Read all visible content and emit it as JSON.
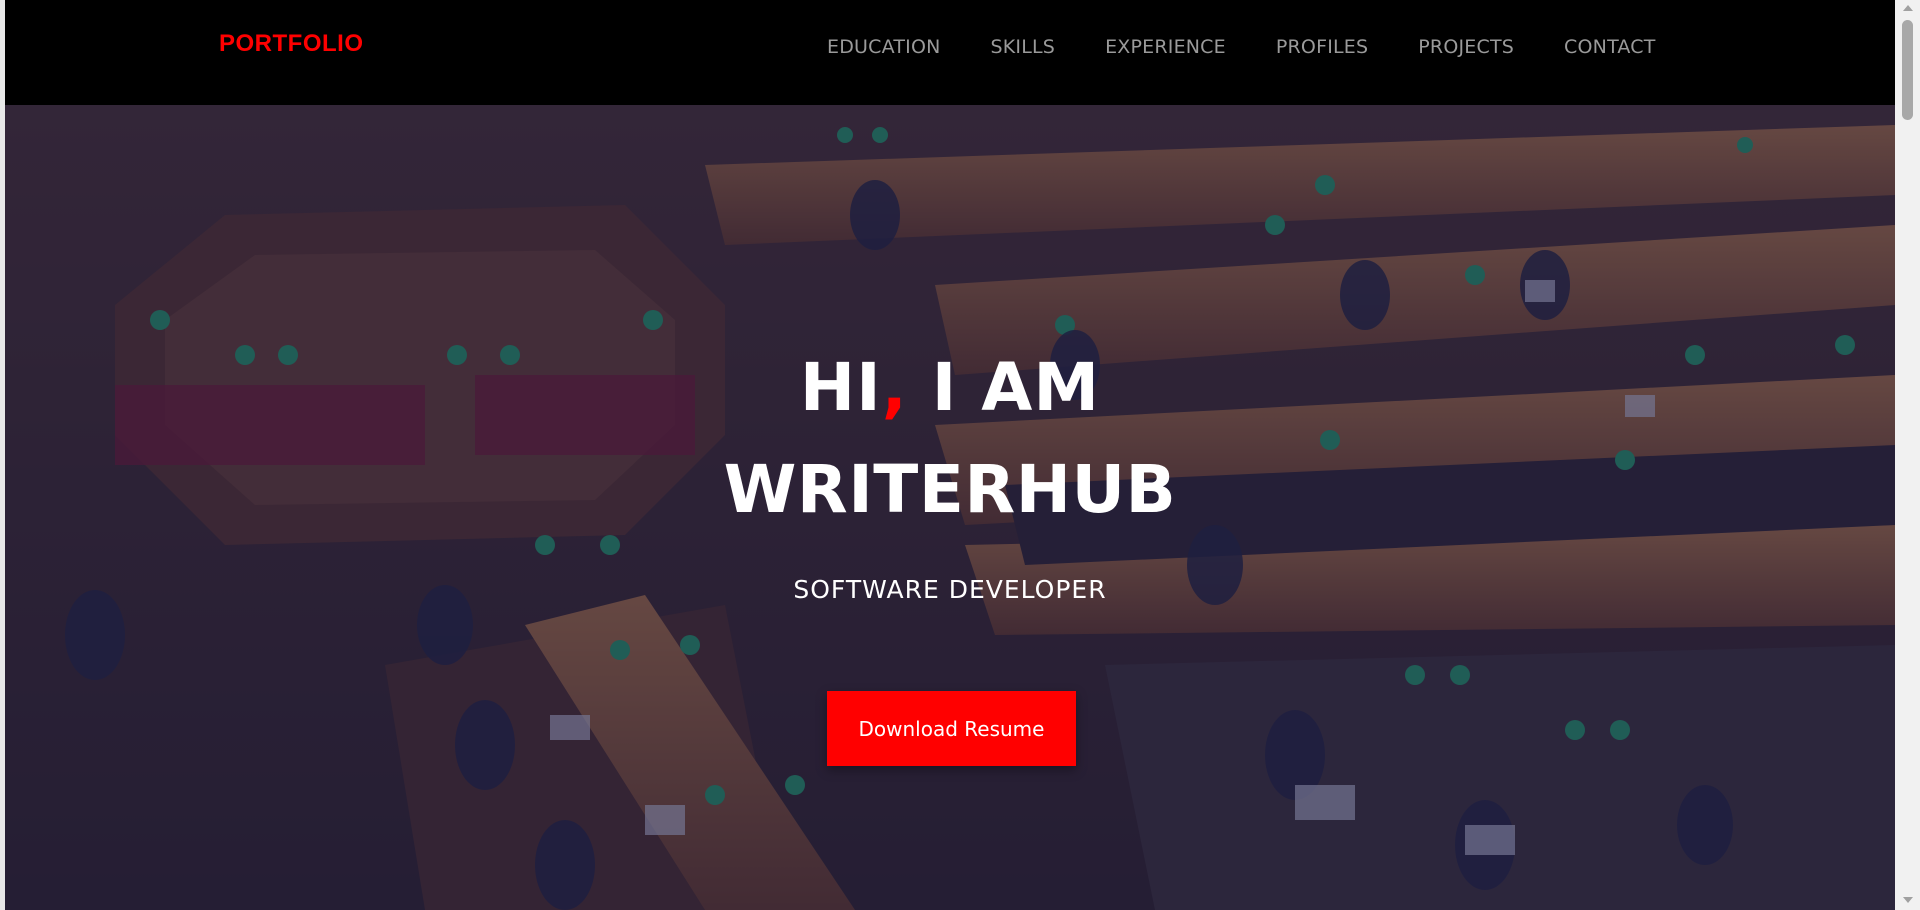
{
  "navbar": {
    "brand": "PORTFOLIO",
    "items": [
      {
        "label": "EDUCATION"
      },
      {
        "label": "SKILLS"
      },
      {
        "label": "EXPERIENCE"
      },
      {
        "label": "PROFILES"
      },
      {
        "label": "PROJECTS"
      },
      {
        "label": "CONTACT"
      }
    ]
  },
  "hero": {
    "greeting_prefix": "HI",
    "greeting_comma": ",",
    "greeting_suffix": " I AM",
    "name": "WRITERHUB",
    "role": "SOFTWARE DEVELOPER",
    "button_label": "Download Resume",
    "background": "library-reading-room-photo"
  },
  "colors": {
    "accent": "#ff0000",
    "navbar_bg": "#000000",
    "nav_text": "#9a9a9a",
    "overlay": "#141646"
  }
}
